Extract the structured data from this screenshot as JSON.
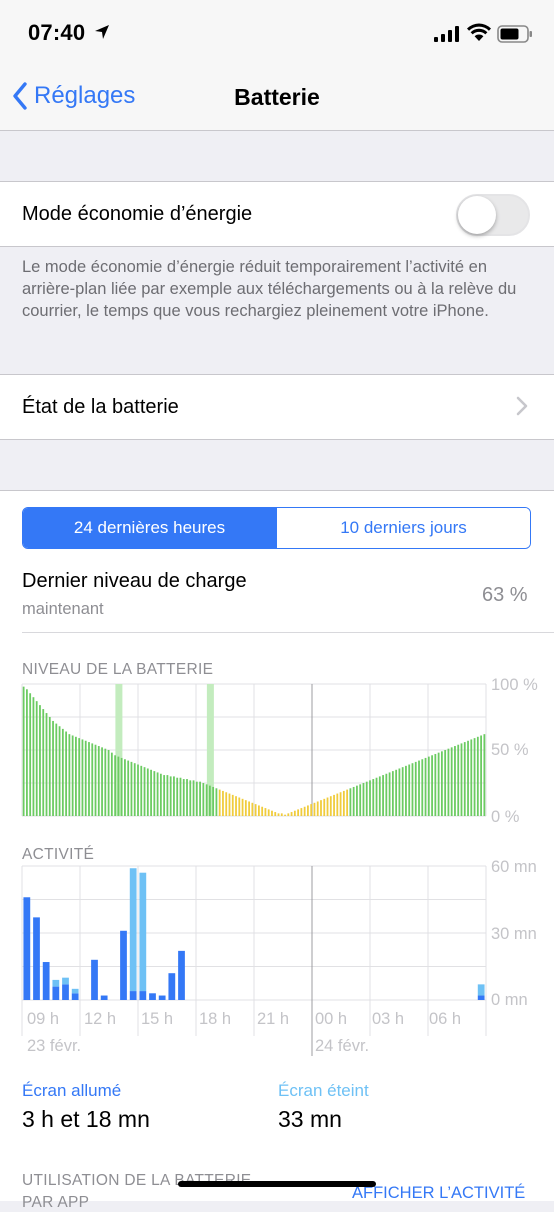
{
  "status_bar": {
    "time": "07:40"
  },
  "nav": {
    "back_label": "Réglages",
    "title": "Batterie"
  },
  "low_power": {
    "label": "Mode économie d’énergie",
    "enabled": false,
    "footnote": "Le mode économie d’énergie réduit temporairement l’activité en arrière-plan liée par exemple aux téléchargements ou à la relève du courrier, le temps que vous rechargiez pleinement votre iPhone."
  },
  "battery_health": {
    "label": "État de la batterie"
  },
  "segments": [
    "24 dernières heures",
    "10 derniers jours"
  ],
  "last_charge": {
    "label": "Dernier niveau de charge",
    "when": "maintenant",
    "value": "63 %"
  },
  "level_chart": {
    "title": "NIVEAU DE LA BATTERIE",
    "y_ticks": [
      "100 %",
      "50 %",
      "0 %"
    ],
    "charging_at_bar": [
      29,
      57
    ],
    "colors": {
      "green": "#6ccb62",
      "yellow": "#f0cc3c",
      "stripe": "#c3ecbe"
    },
    "values": [
      98,
      96,
      93,
      90,
      87,
      84,
      81,
      78,
      75,
      72,
      70,
      68,
      66,
      64,
      62,
      61,
      60,
      59,
      58,
      57,
      56,
      55,
      54,
      53,
      52,
      51,
      50,
      48,
      46,
      45,
      44,
      43,
      42,
      41,
      40,
      39,
      38,
      37,
      36,
      35,
      34,
      33,
      32,
      31,
      31,
      30,
      30,
      29,
      29,
      28,
      28,
      27,
      27,
      26,
      26,
      25,
      24,
      23,
      22,
      21,
      20,
      19,
      18,
      17,
      16,
      15,
      14,
      13,
      12,
      11,
      10,
      9,
      8,
      7,
      6,
      5,
      4,
      3,
      2,
      2,
      1,
      2,
      3,
      4,
      5,
      6,
      7,
      8,
      9,
      10,
      11,
      12,
      13,
      14,
      15,
      16,
      17,
      18,
      19,
      20,
      21,
      22,
      23,
      24,
      25,
      26,
      27,
      28,
      29,
      30,
      31,
      32,
      33,
      34,
      35,
      36,
      37,
      38,
      39,
      40,
      41,
      42,
      43,
      44,
      45,
      46,
      47,
      48,
      49,
      50,
      51,
      52,
      53,
      54,
      55,
      56,
      57,
      58,
      59,
      60,
      61,
      62
    ]
  },
  "activity_chart": {
    "title": "ACTIVITÉ",
    "y_ticks": [
      "60 mn",
      "30 mn",
      "0 mn"
    ],
    "x_ticks": [
      "09 h",
      "12 h",
      "15 h",
      "18 h",
      "21 h",
      "00 h",
      "03 h",
      "06 h"
    ],
    "dates": [
      "23 févr.",
      "24 févr."
    ],
    "colors": {
      "on": "#3478f6",
      "off": "#6ec1f5"
    },
    "screen_on": [
      46,
      37,
      17,
      6,
      7,
      3,
      0,
      18,
      2,
      0,
      31,
      4,
      4,
      3,
      2,
      12,
      22,
      0,
      0,
      0,
      0,
      0,
      0,
      0,
      0,
      0,
      0,
      0,
      0,
      0,
      0,
      0,
      0,
      0,
      0,
      0,
      0,
      0,
      0,
      0,
      0,
      0,
      0,
      0,
      0,
      0,
      0,
      2
    ],
    "screen_off": [
      0,
      0,
      0,
      3,
      3,
      2,
      0,
      0,
      0,
      0,
      0,
      55,
      53,
      0,
      0,
      0,
      0,
      0,
      0,
      0,
      0,
      0,
      0,
      0,
      0,
      0,
      0,
      0,
      0,
      0,
      0,
      0,
      0,
      0,
      0,
      0,
      0,
      0,
      0,
      0,
      0,
      0,
      0,
      0,
      0,
      0,
      0,
      5
    ]
  },
  "screen_on": {
    "label": "Écran allumé",
    "value": "3 h et 18 mn"
  },
  "screen_off": {
    "label": "Écran éteint",
    "value": "33 mn"
  },
  "usage": {
    "title": "UTILISATION DE LA BATTERIE",
    "subtitle": "PAR APP",
    "link": "AFFICHER L’ACTIVITÉ"
  }
}
